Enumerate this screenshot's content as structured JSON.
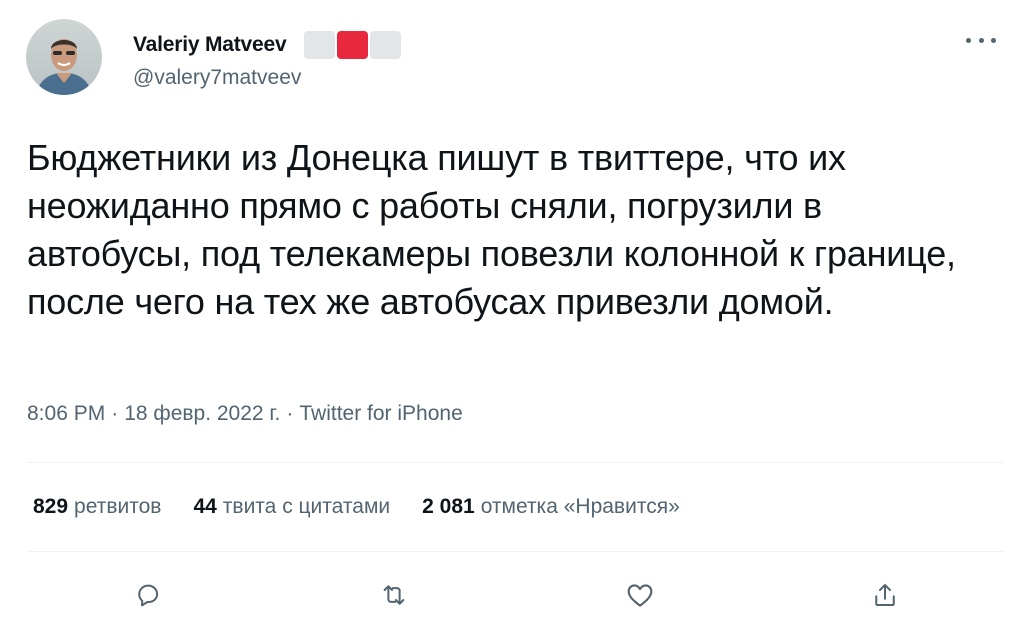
{
  "user": {
    "display_name": "Valeriy Matveev",
    "handle": "@valery7matveev",
    "avatar_icon": "avatar-photo",
    "flag_colors": [
      "#e3e6e8",
      "#e8283c",
      "#e3e6e8"
    ]
  },
  "tweet": {
    "text": "Бюджетники из Донецка пишут в твиттере, что их неожиданно прямо с работы сняли, погрузили в автобусы, под телекамеры повезли колонной к границе, после чего на тех же автобусах привезли домой.",
    "time": "8:06 PM",
    "date": "18 февр. 2022 г.",
    "separator": "·",
    "source": "Twitter for iPhone"
  },
  "stats": {
    "retweets_count": "829",
    "retweets_label": "ретвитов",
    "quotes_count": "44",
    "quotes_label": "твита с цитатами",
    "likes_count": "2 081",
    "likes_label": "отметка «Нравится»"
  },
  "actions": {
    "reply_icon": "reply-icon",
    "retweet_icon": "retweet-icon",
    "like_icon": "heart-icon",
    "share_icon": "share-icon"
  },
  "colors": {
    "text_primary": "#0f1419",
    "text_secondary": "#536471",
    "divider": "#eff3f4"
  }
}
